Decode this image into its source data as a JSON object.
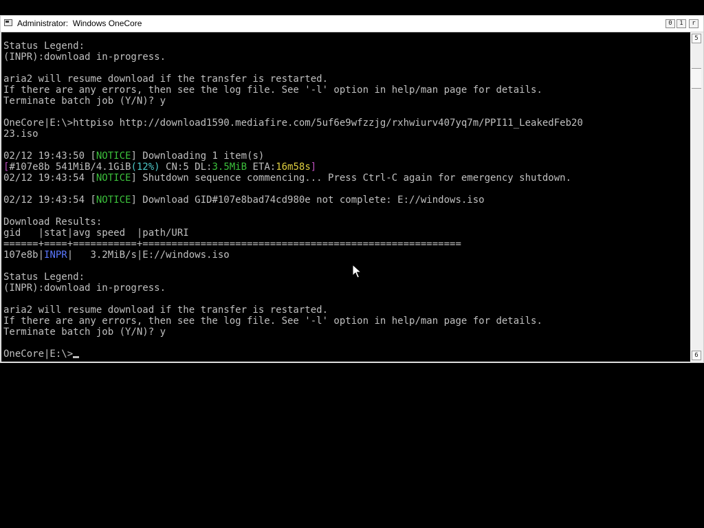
{
  "window": {
    "title": "Administrator:  Windows OneCore",
    "controls": {
      "minimize": "0",
      "maximize": "1",
      "close": "r"
    },
    "scrollbar": {
      "up": "5",
      "down": "6"
    }
  },
  "console": {
    "lines": [
      [
        {
          "t": "Status Legend:"
        }
      ],
      [
        {
          "t": "(INPR):download in-progress."
        }
      ],
      [
        {
          "t": ""
        }
      ],
      [
        {
          "t": "aria2 will resume download if the transfer is restarted."
        }
      ],
      [
        {
          "t": "If there are any errors, then see the log file. See '-l' option in help/man page for details."
        }
      ],
      [
        {
          "t": "Terminate batch job (Y/N)? y"
        }
      ],
      [
        {
          "t": ""
        }
      ],
      [
        {
          "t": "OneCore|E:\\>httpiso http://download1590.mediafire.com/5uf6e9wfzzjg/rxhwiurv407yq7m/PPI11_LeakedFeb20"
        }
      ],
      [
        {
          "t": "23.iso"
        }
      ],
      [
        {
          "t": ""
        }
      ],
      [
        {
          "t": "02/12 19:43:50 ["
        },
        {
          "t": "NOTICE",
          "c": "notice"
        },
        {
          "t": "] Downloading 1 item(s)"
        }
      ],
      [
        {
          "t": "[",
          "c": "magenta"
        },
        {
          "t": "#107e8b 541MiB/4.1GiB"
        },
        {
          "t": "(12%)",
          "c": "cyan"
        },
        {
          "t": " CN:5 DL:"
        },
        {
          "t": "3.5MiB",
          "c": "green"
        },
        {
          "t": " ETA:"
        },
        {
          "t": "16m58s",
          "c": "yellow"
        },
        {
          "t": "]",
          "c": "magenta"
        }
      ],
      [
        {
          "t": "02/12 19:43:54 ["
        },
        {
          "t": "NOTICE",
          "c": "notice"
        },
        {
          "t": "] Shutdown sequence commencing... Press Ctrl-C again for emergency shutdown."
        }
      ],
      [
        {
          "t": ""
        }
      ],
      [
        {
          "t": "02/12 19:43:54 ["
        },
        {
          "t": "NOTICE",
          "c": "notice"
        },
        {
          "t": "] Download GID#107e8bad74cd980e not complete: E://windows.iso"
        }
      ],
      [
        {
          "t": ""
        }
      ],
      [
        {
          "t": "Download Results:"
        }
      ],
      [
        {
          "t": "gid   |stat|avg speed  |path/URI"
        }
      ],
      [
        {
          "t": "======+====+===========+======================================================="
        }
      ],
      [
        {
          "t": "107e8b|"
        },
        {
          "t": "INPR",
          "c": "blue"
        },
        {
          "t": "|   3.2MiB/s|E://windows.iso"
        }
      ],
      [
        {
          "t": ""
        }
      ],
      [
        {
          "t": "Status Legend:"
        }
      ],
      [
        {
          "t": "(INPR):download in-progress."
        }
      ],
      [
        {
          "t": ""
        }
      ],
      [
        {
          "t": "aria2 will resume download if the transfer is restarted."
        }
      ],
      [
        {
          "t": "If there are any errors, then see the log file. See '-l' option in help/man page for details."
        }
      ],
      [
        {
          "t": "Terminate batch job (Y/N)? y"
        }
      ],
      [
        {
          "t": ""
        }
      ],
      [
        {
          "t": "OneCore|E:\\>"
        },
        {
          "cursor": true
        }
      ]
    ]
  },
  "colors": {
    "console_bg": "#000000",
    "console_fg": "#c0c0c0",
    "notice": "#3cc23c",
    "magenta": "#c050c0",
    "cyan": "#4ec9c9",
    "yellow": "#e0d040",
    "blue": "#5a78ff"
  },
  "icons": {
    "window_icon": "console-window-icon",
    "pointer": "mouse-pointer-icon"
  }
}
